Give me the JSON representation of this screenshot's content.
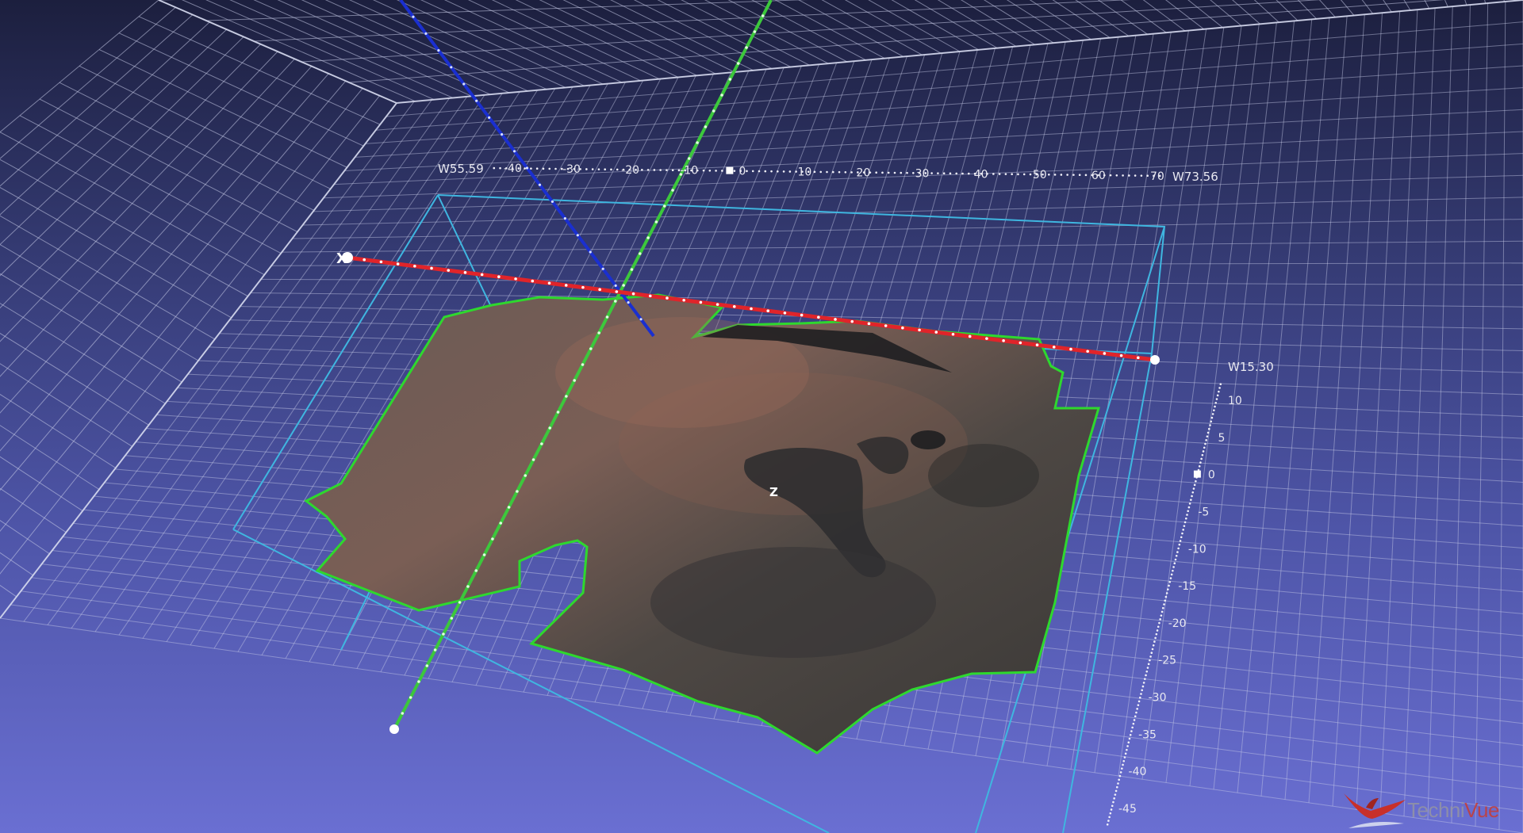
{
  "app": {
    "brand": {
      "prefix": "Techni",
      "highlight": "Vue"
    }
  },
  "axes": {
    "x_scale": {
      "start_label": "W55.59",
      "end_label": "W73.56",
      "ticks": [
        "-40",
        "-30",
        "-20",
        "-10",
        "0",
        "10",
        "20",
        "30",
        "40",
        "50",
        "60",
        "70"
      ]
    },
    "z_scale": {
      "top_label": "W15.30",
      "ticks": [
        "10",
        "5",
        "0",
        "-5",
        "-10",
        "-15",
        "-20",
        "-25",
        "-30",
        "-35",
        "-40",
        "-45"
      ]
    },
    "labels": {
      "x_axis": "X",
      "z_axis": "Z"
    }
  },
  "colors": {
    "x_axis": "#e0242a",
    "y_axis": "#3cc83c",
    "z_axis": "#1a2fd0",
    "bounding_box": "#3fb6e0",
    "terrain_outline": "#2ed82e",
    "grid": "#c8cce8"
  },
  "icons": {
    "logo": "bird-logo-icon"
  }
}
